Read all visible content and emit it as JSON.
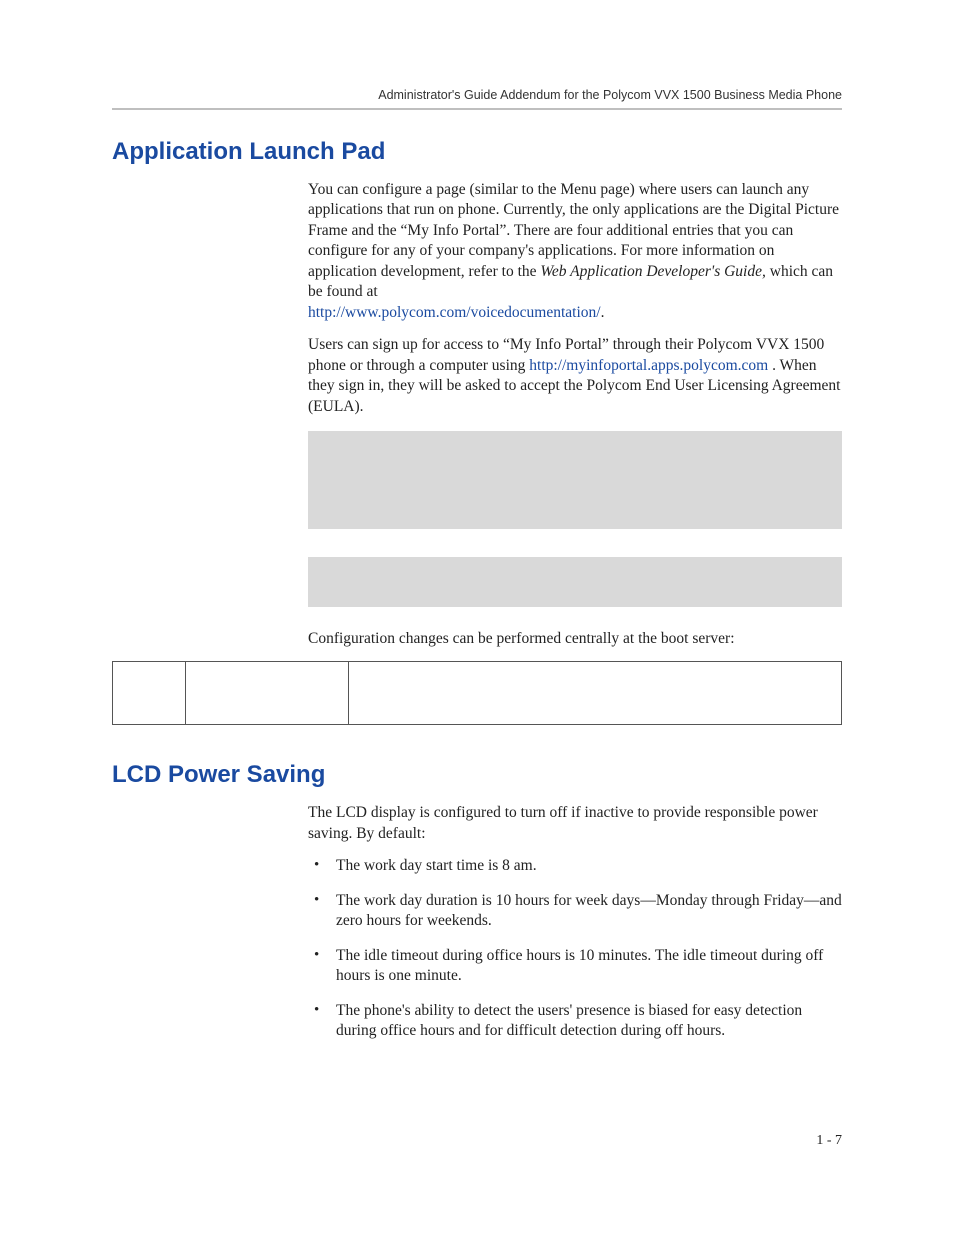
{
  "header": {
    "running": "Administrator's Guide Addendum for the Polycom VVX 1500 Business Media Phone"
  },
  "section1": {
    "title": "Application Launch Pad",
    "p1a": "You can configure a page (similar to the Menu page) where users can launch any applications that run on phone. Currently, the only applications are the Digital Picture Frame and the “My Info Portal”. There are four additional entries that you can configure for any of your company's applications. For more information on application development, refer to the ",
    "p1_em": "Web Application Developer's Guide,",
    "p1b": " which can be found at ",
    "link1": "http://www.polycom.com/voicedocumentation/",
    "p1c": ".",
    "p2a": "Users can sign up for access to “My Info Portal” through their Polycom VVX 1500 phone or through a computer using ",
    "link2": "http://myinfoportal.apps.polycom.com",
    "p2b": " . When they sign in, they will be asked to accept the Polycom End User Licensing Agreement (EULA).",
    "config_line": "Configuration changes can be performed centrally at the boot server:"
  },
  "section2": {
    "title": "LCD Power Saving",
    "intro": "The LCD display is configured to turn off if inactive to provide responsible power saving. By default:",
    "bullets": [
      "The work day start time is 8 am.",
      "The work day duration is 10 hours for week days—Monday through Friday—and zero hours for weekends.",
      "The idle timeout during office hours is 10 minutes. The idle timeout during off hours is one minute.",
      "The phone's ability to detect the users' presence is biased for easy detection during office hours and for difficult detection during off hours."
    ]
  },
  "footer": {
    "page": "1 - 7"
  }
}
